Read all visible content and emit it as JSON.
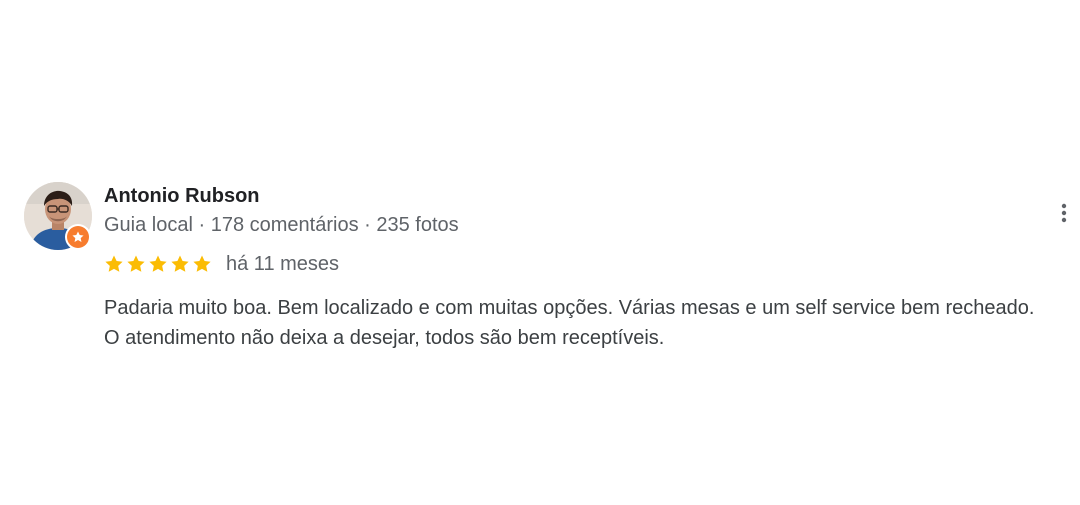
{
  "review": {
    "reviewer_name": "Antonio Rubson",
    "reviewer_role": "Guia local",
    "separator": " · ",
    "reviews_count": "178 comentários",
    "photos_count": "235 fotos",
    "rating": 5,
    "rating_max": 5,
    "time_ago": "há 11 meses",
    "text": "Padaria muito boa. Bem localizado e com muitas opções. Várias mesas e um self service bem recheado. O atendimento não deixa a desejar, todos são bem receptíveis."
  },
  "icons": {
    "avatar": "avatar",
    "local-guide-badge": "star-badge-icon",
    "star": "star-icon",
    "more": "more-vert-icon"
  },
  "colors": {
    "star": "#fbbc04",
    "badge": "#f77c2e",
    "name": "#202124",
    "secondary": "#5f6368",
    "body": "#3c4043"
  }
}
